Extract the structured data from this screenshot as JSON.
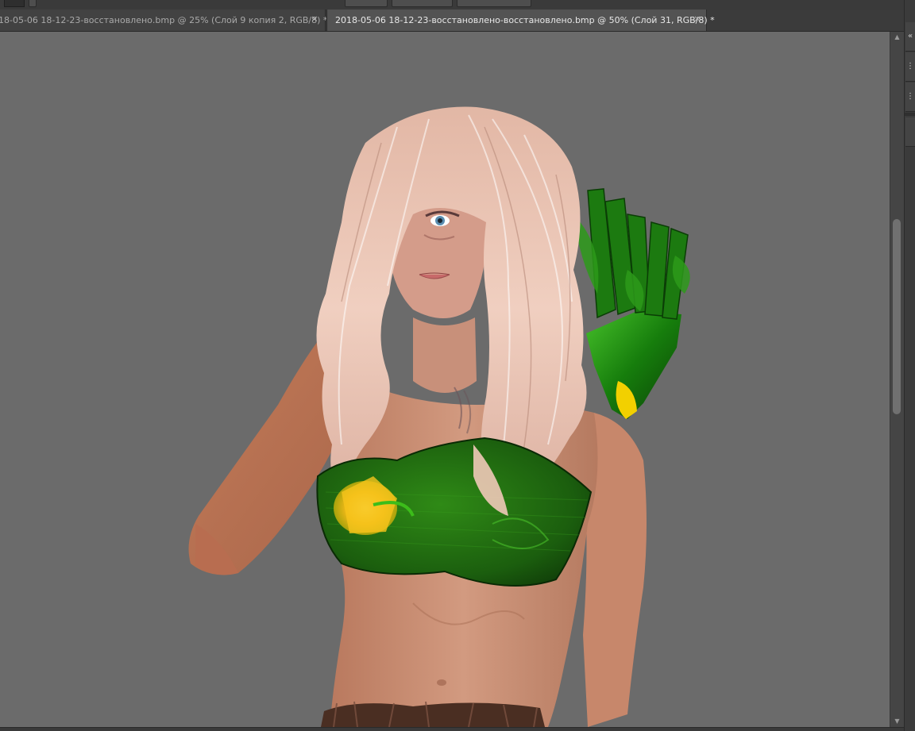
{
  "tabs": [
    {
      "label": "18-05-06 18-12-23-восстановлено.bmp @ 25% (Слой 9 копия 2, RGB/8) *",
      "close_glyph": "×",
      "active": false
    },
    {
      "label": "2018-05-06 18-12-23-восстановлено-восстановлено.bmp @ 50% (Слой 31, RGB/8) *",
      "close_glyph": "×",
      "active": true
    }
  ],
  "icons": {
    "scroll_up": "chevron-up-icon",
    "scroll_down": "chevron-down-icon",
    "panel_collapse": "double-chevron-icon",
    "panel_grip": "grip-icon"
  },
  "glyphs": {
    "scroll_up": "▲",
    "scroll_down": "▼",
    "panel_collapse": "«",
    "panel_grip": "⋮"
  },
  "colors": {
    "workspace": "#535353",
    "canvas_bg": "#6b6b6b",
    "tab_active_bg": "#535353",
    "tab_inactive_bg": "#424242",
    "hair": "#e8c4b4",
    "skin": "#c98e72",
    "top_green": "#1f6e10",
    "flower_yellow": "#f1c01a"
  },
  "scroll": {
    "vertical_position": 0.27,
    "vertical_visible_fraction": 0.28
  }
}
